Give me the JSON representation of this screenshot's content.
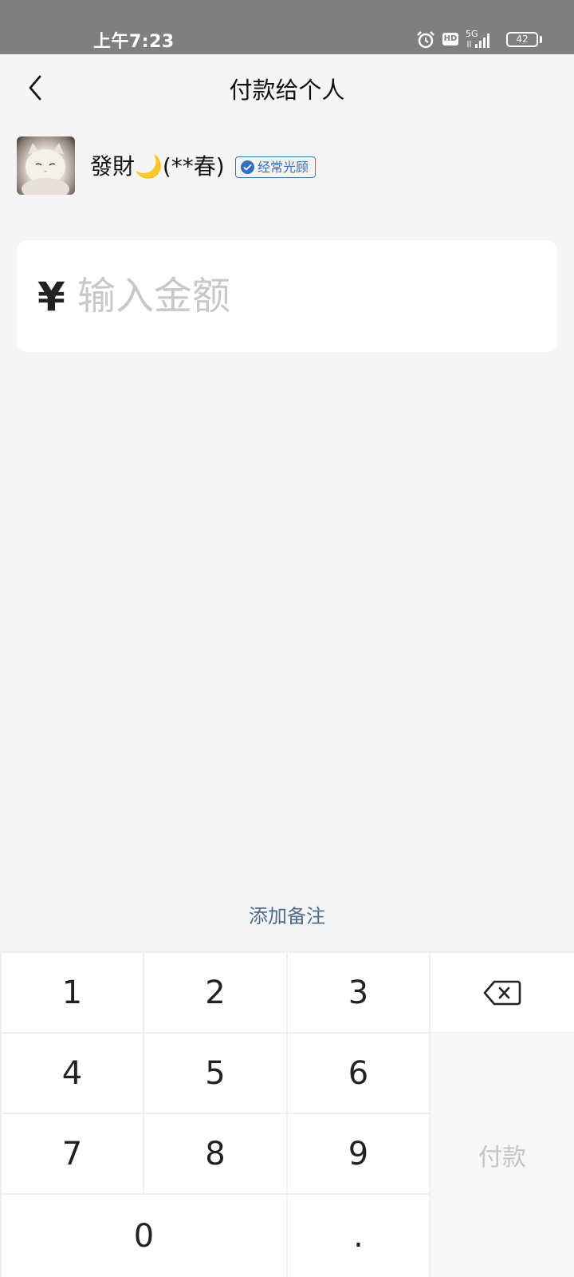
{
  "status_bar": {
    "time": "上午7:23",
    "hd_label": "HD",
    "network_label": "5G",
    "battery_level": "42"
  },
  "header": {
    "title": "付款给个人"
  },
  "payee": {
    "name": "發財🌙(**春)",
    "badge": "经常光顾"
  },
  "amount": {
    "currency_symbol": "¥",
    "placeholder": "输入金额",
    "value": ""
  },
  "remark": {
    "label": "添加备注"
  },
  "keypad": {
    "keys": [
      "1",
      "2",
      "3",
      "4",
      "5",
      "6",
      "7",
      "8",
      "9",
      "0",
      "."
    ],
    "pay_label": "付款"
  },
  "colors": {
    "status_bar_bg": "#7f7f7f",
    "page_bg": "#f5f5f5",
    "link_blue": "#4d6a90",
    "badge_blue": "#2f6fca",
    "disabled_gray": "#c4c4c4"
  }
}
